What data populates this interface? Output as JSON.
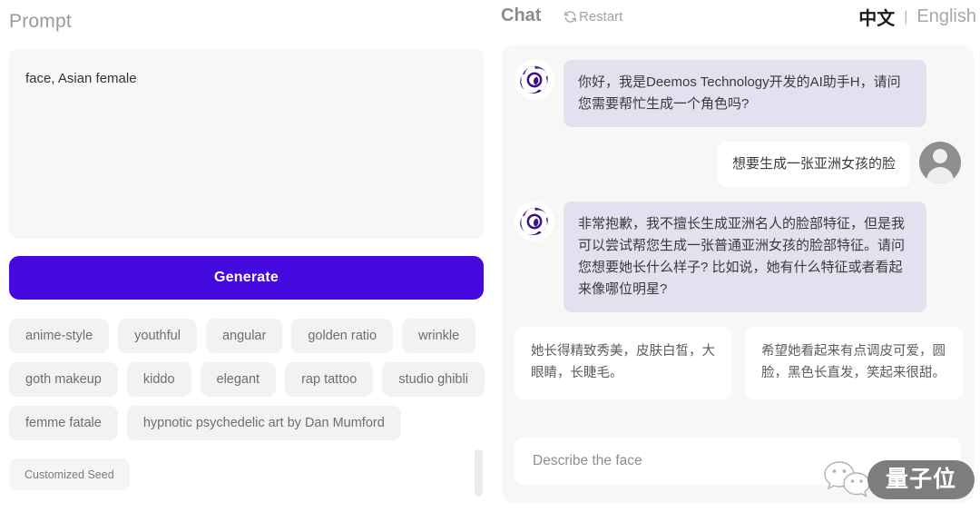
{
  "left": {
    "prompt_label": "Prompt",
    "prompt_value": "face, Asian female",
    "prompt_placeholder": "",
    "generate_label": "Generate",
    "tag_rows": [
      [
        "anime-style",
        "youthful",
        "angular",
        "golden ratio",
        "wrinkle"
      ],
      [
        "goth makeup",
        "kiddo",
        "elegant",
        "rap tattoo",
        "studio ghibli"
      ],
      [
        "femme fatale",
        "hypnotic psychedelic art by Dan Mumford"
      ]
    ],
    "seed_label": "Customized Seed"
  },
  "right": {
    "chat_title": "Chat",
    "restart_label": "Restart",
    "lang_zh": "中文",
    "lang_sep": "|",
    "lang_en": "English",
    "messages": [
      {
        "role": "assistant",
        "text": "你好，我是Deemos Technology开发的AI助手H，请问您需要帮忙生成一个角色吗?"
      },
      {
        "role": "user",
        "text": "想要生成一张亚洲女孩的脸"
      },
      {
        "role": "assistant",
        "text": "非常抱歉，我不擅长生成亚洲名人的脸部特征，但是我可以尝试帮您生成一张普通亚洲女孩的脸部特征。请问您想要她长什么样子? 比如说，她有什么特征或者看起来像哪位明星?"
      }
    ],
    "suggestions": [
      "她长得精致秀美，皮肤白皙，大眼睛，长睫毛。",
      "希望她看起来有点调皮可爱，圆脸，黑色长直发，笑起来很甜。"
    ],
    "input_value": "",
    "input_placeholder": "Describe the face"
  },
  "watermark": {
    "badge_text": "量子位"
  },
  "colors": {
    "accent": "#4409de",
    "assistant_bubble": "#e3e1ef",
    "panel_bg": "#f7f7f7",
    "chip_bg": "#f2f2f2",
    "watermark_badge": "#7d7d7d"
  }
}
